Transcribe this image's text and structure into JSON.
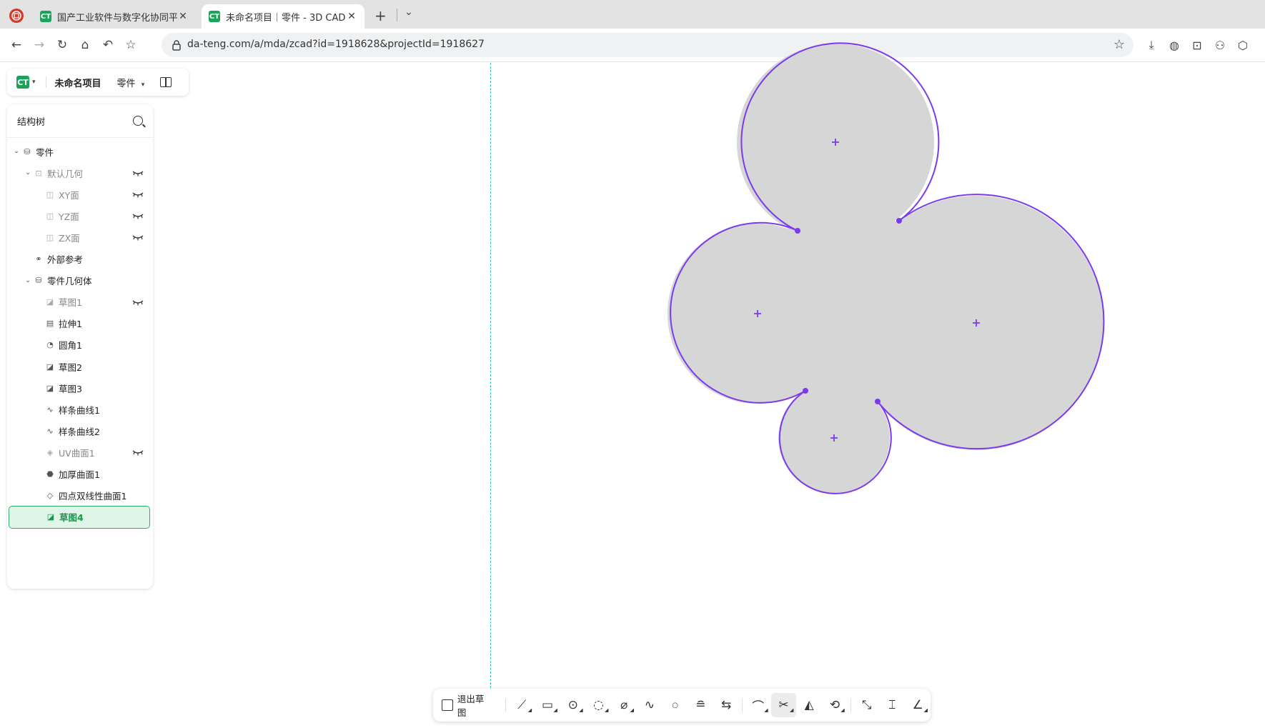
{
  "browser": {
    "tabs": [
      {
        "title": "国产工业软件与数字化协同平",
        "active": false
      },
      {
        "title": "未命名项目｜零件 - 3D CAD",
        "active": true
      }
    ],
    "url": "da-teng.com/a/mda/zcad?id=1918628&projectId=1918627"
  },
  "app": {
    "logo": "CT",
    "project_name": "未命名项目",
    "doc_type": "零件",
    "tree": {
      "title": "结构树",
      "items": [
        {
          "label": "零件",
          "level": 0,
          "caret": true,
          "icon": "part-icon",
          "dim": false,
          "eye": false
        },
        {
          "label": "默认几何",
          "level": 1,
          "caret": true,
          "icon": "default-geometry-icon",
          "dim": true,
          "eye": true
        },
        {
          "label": "XY面",
          "level": 2,
          "caret": false,
          "icon": "plane-icon",
          "dim": true,
          "eye": true
        },
        {
          "label": "YZ面",
          "level": 2,
          "caret": false,
          "icon": "plane-icon",
          "dim": true,
          "eye": true
        },
        {
          "label": "ZX面",
          "level": 2,
          "caret": false,
          "icon": "plane-icon",
          "dim": true,
          "eye": true
        },
        {
          "label": "外部参考",
          "level": 1,
          "caret": false,
          "icon": "external-reference-icon",
          "dim": false,
          "eye": false
        },
        {
          "label": "零件几何体",
          "level": 1,
          "caret": true,
          "icon": "part-body-icon",
          "dim": false,
          "eye": false
        },
        {
          "label": "草图1",
          "level": 2,
          "caret": false,
          "icon": "sketch-icon",
          "dim": true,
          "eye": true
        },
        {
          "label": "拉伸1",
          "level": 2,
          "caret": false,
          "icon": "extrude-icon",
          "dim": false,
          "eye": false
        },
        {
          "label": "圆角1",
          "level": 2,
          "caret": false,
          "icon": "fillet-icon",
          "dim": false,
          "eye": false
        },
        {
          "label": "草图2",
          "level": 2,
          "caret": false,
          "icon": "sketch-icon",
          "dim": false,
          "eye": false
        },
        {
          "label": "草图3",
          "level": 2,
          "caret": false,
          "icon": "sketch-icon",
          "dim": false,
          "eye": false
        },
        {
          "label": "样条曲线1",
          "level": 2,
          "caret": false,
          "icon": "spline-icon",
          "dim": false,
          "eye": false
        },
        {
          "label": "样条曲线2",
          "level": 2,
          "caret": false,
          "icon": "spline-icon",
          "dim": false,
          "eye": false
        },
        {
          "label": "UV曲面1",
          "level": 2,
          "caret": false,
          "icon": "uv-surface-icon",
          "dim": true,
          "eye": true
        },
        {
          "label": "加厚曲面1",
          "level": 2,
          "caret": false,
          "icon": "thicken-surface-icon",
          "dim": false,
          "eye": false
        },
        {
          "label": "四点双线性曲面1",
          "level": 2,
          "caret": false,
          "icon": "bilinear-surface-icon",
          "dim": false,
          "eye": false
        },
        {
          "label": "草图4",
          "level": 2,
          "caret": false,
          "icon": "sketch-icon",
          "dim": false,
          "eye": false,
          "selected": true
        }
      ]
    },
    "toolbar": {
      "exit_label": "退出草图",
      "tools": [
        "line-tool-icon",
        "rectangle-tool-icon",
        "circle-tool-icon",
        "arc-tool-icon",
        "slot-tool-icon",
        "spline-tool-icon",
        "point-tool-icon",
        "text-tool-icon",
        "offset-tool-icon",
        "fillet-tool-icon",
        "trim-tool-icon",
        "mirror-tool-icon",
        "transform-tool-icon",
        "extend-tool-icon",
        "dimension-tool-icon",
        "constraint-tool-icon"
      ],
      "active_tool": "trim-tool-icon"
    },
    "colors": {
      "accent": "#1aa35a",
      "sketch_stroke": "#7c3aed",
      "sketch_fill": "#d6d6d6",
      "axis": "#34c5b6"
    }
  }
}
